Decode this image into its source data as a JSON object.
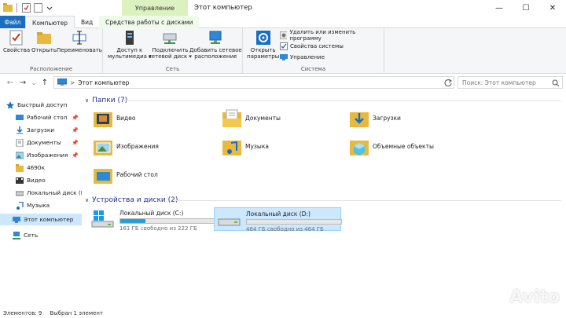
{
  "titlebar": {
    "context_tab": "Управление",
    "title": "Этот компьютер",
    "minimize": "—",
    "maximize": "☐",
    "close": "✕"
  },
  "tabs": {
    "file": "Файл",
    "computer": "Компьютер",
    "view": "Вид",
    "drive_tools": "Средства работы с дисками"
  },
  "ribbon": {
    "location": {
      "label": "Расположение",
      "properties": "Свойства",
      "open": "Открыть",
      "rename": "Переименовать"
    },
    "network": {
      "label": "Сеть",
      "media_access_1": "Доступ к",
      "media_access_2": "мультимедиа ▾",
      "map_drive_1": "Подключить",
      "map_drive_2": "сетевой диск ▾",
      "add_location_1": "Добавить сетевое",
      "add_location_2": "расположение"
    },
    "system": {
      "label": "Система",
      "open_settings_1": "Открыть",
      "open_settings_2": "параметры",
      "uninstall": "Удалить или изменить программу",
      "system_properties": "Свойства системы",
      "manage": "Управление"
    }
  },
  "navbar": {
    "back": "←",
    "forward": "→",
    "recent": "⌄",
    "up": "↑",
    "path": "Этот компьютер",
    "path_chevron": ">",
    "search_placeholder": "Поиск: Этот компьютер"
  },
  "sidebar": {
    "items": [
      {
        "label": "Быстрый доступ"
      },
      {
        "label": "Рабочий стол"
      },
      {
        "label": "Загрузки"
      },
      {
        "label": "Документы"
      },
      {
        "label": "Изображения"
      },
      {
        "label": "4690к"
      },
      {
        "label": "Видео"
      },
      {
        "label": "Локальный диск (D"
      },
      {
        "label": "Музыка"
      },
      {
        "label": "Этот компьютер"
      },
      {
        "label": "Сеть"
      }
    ]
  },
  "main": {
    "folders_header": "Папки (7)",
    "folders": [
      {
        "name": "Видео"
      },
      {
        "name": "Документы"
      },
      {
        "name": "Загрузки"
      },
      {
        "name": "Изображения"
      },
      {
        "name": "Музыка"
      },
      {
        "name": "Объемные объекты"
      },
      {
        "name": "Рабочий стол"
      }
    ],
    "devices_header": "Устройства и диски (2)",
    "drives": [
      {
        "name": "Локальный диск (C:)",
        "free": "161 ГБ свободно из 222 ГБ",
        "used_fraction": 0.27
      },
      {
        "name": "Локальный диск (D:)",
        "free": "464 ГБ свободно из 464 ГБ",
        "used_fraction": 0.0
      }
    ]
  },
  "status": {
    "items": "Элементов: 9",
    "selected": "Выбран 1 элемент"
  },
  "watermark": "Avito",
  "colors": {
    "accent": "#1a6ec2",
    "selection": "#cce8ff",
    "drive_fill": "#26a0da",
    "context_tab": "#dbf1c0"
  }
}
